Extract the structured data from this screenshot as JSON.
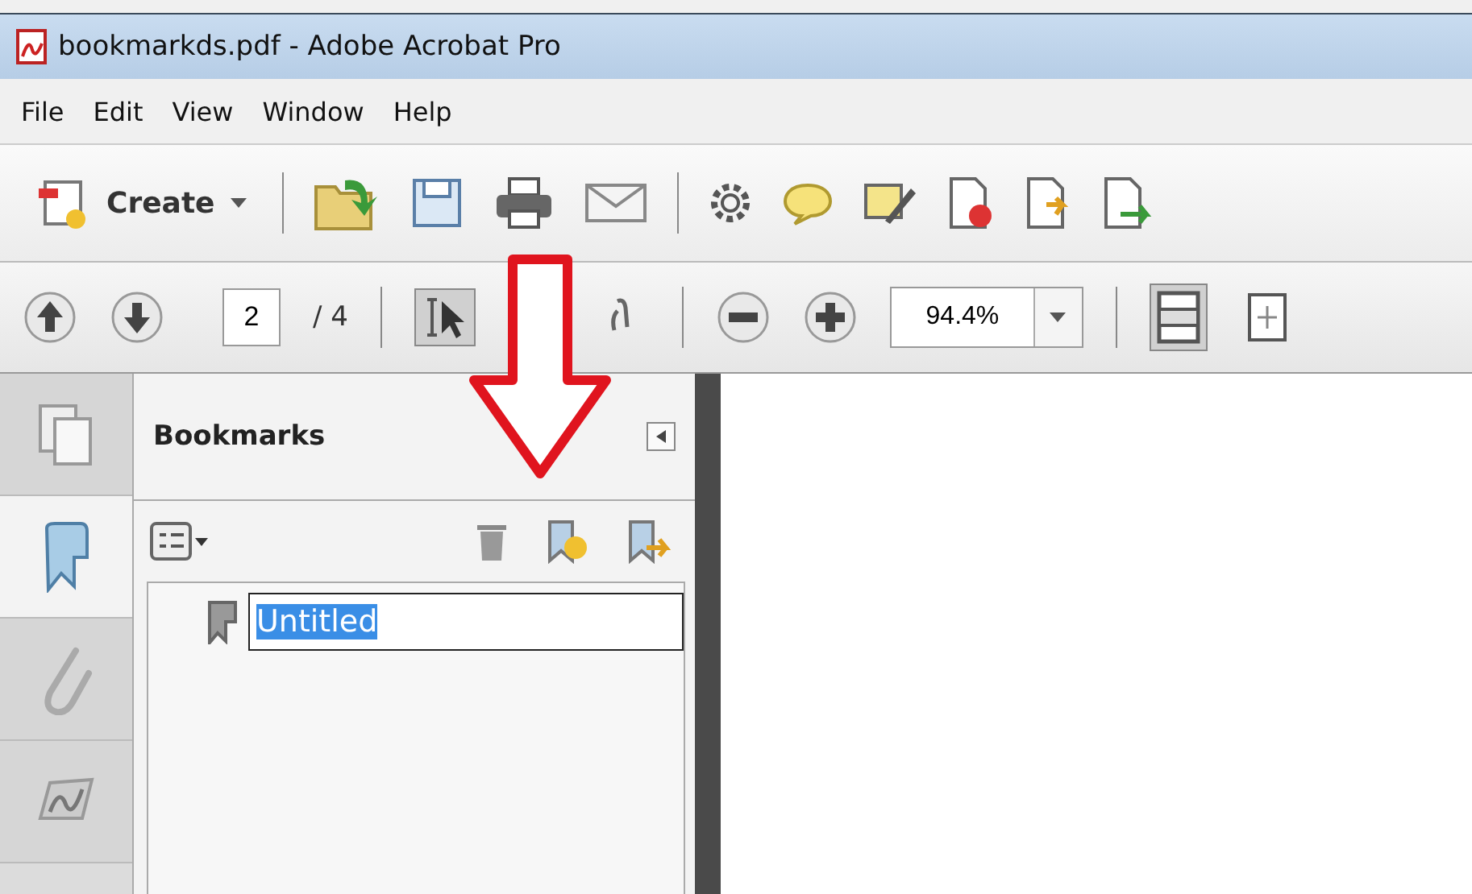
{
  "window": {
    "title": "bookmarkds.pdf - Adobe Acrobat Pro"
  },
  "menu": [
    "File",
    "Edit",
    "View",
    "Window",
    "Help"
  ],
  "toolbar": {
    "create_label": "Create"
  },
  "nav": {
    "page": "2",
    "page_total": "/ 4",
    "zoom": "94.4%"
  },
  "tools": [
    {
      "kind": "select",
      "selected": true
    },
    {
      "kind": "hand",
      "selected": false
    }
  ],
  "fit_buttons": [
    {
      "kind": "fit-page",
      "selected": true
    },
    {
      "kind": "fit-width",
      "selected": false
    }
  ],
  "rail": [
    {
      "kind": "pages",
      "selected": false
    },
    {
      "kind": "bookmarks",
      "selected": true
    },
    {
      "kind": "attachments",
      "selected": false
    },
    {
      "kind": "signatures",
      "selected": false
    }
  ],
  "panel": {
    "title": "Bookmarks"
  },
  "bookmarks": [
    {
      "label": "Untitled",
      "editing": true
    }
  ]
}
